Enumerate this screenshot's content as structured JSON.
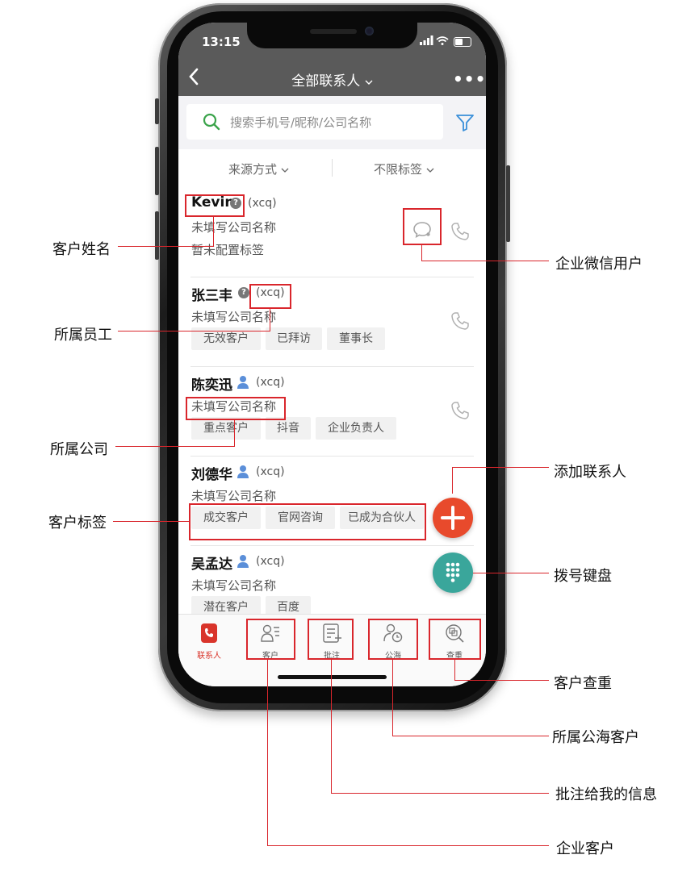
{
  "status_bar": {
    "time": "13:15"
  },
  "nav": {
    "title": "全部联系人",
    "title_dropdown_icon": "chevron-down-icon",
    "back_icon": "chevron-left-icon",
    "more_icon": "more-icon",
    "more_glyph": "•••"
  },
  "search": {
    "placeholder": "搜索手机号/昵称/公司名称"
  },
  "filters": [
    {
      "label": "来源方式"
    },
    {
      "label": "不限标签"
    }
  ],
  "contacts": [
    {
      "name": "Kevin",
      "staff": "(xcq)",
      "company": "未填写公司名称",
      "note": "暂未配置标签",
      "tags": [],
      "wechat_user": true
    },
    {
      "name": "张三丰",
      "staff": "(xcq)",
      "company": "未填写公司名称",
      "tags": [
        "无效客户",
        "已拜访",
        "董事长"
      ]
    },
    {
      "name": "陈奕迅",
      "staff": "(xcq)",
      "company": "未填写公司名称",
      "tags": [
        "重点客户",
        "抖音",
        "企业负责人"
      ]
    },
    {
      "name": "刘德华",
      "staff": "(xcq)",
      "company": "未填写公司名称",
      "tags": [
        "成交客户",
        "官网咨询",
        "已成为合伙人"
      ]
    },
    {
      "name": "吴孟达",
      "staff": "(xcq)",
      "company": "未填写公司名称",
      "tags": [
        "潜在客户",
        "百度"
      ]
    }
  ],
  "tabs": [
    {
      "label": "联系人",
      "active": true
    },
    {
      "label": "客户"
    },
    {
      "label": "批注"
    },
    {
      "label": "公海"
    },
    {
      "label": "查重"
    }
  ],
  "annotations": {
    "customer_name": "客户姓名",
    "wechat_user": "企业微信用户",
    "staff": "所属员工",
    "company": "所属公司",
    "add_contact": "添加联系人",
    "tags": "客户标签",
    "dial_pad": "拨号键盘",
    "dedupe": "客户查重",
    "public_pool": "所属公海客户",
    "annotations_to_me": "批注给我的信息",
    "enterprise_customer": "企业客户"
  },
  "colors": {
    "accent_red": "#d9262c",
    "fab_add": "#e84a2c",
    "fab_dial": "#3aa69b",
    "header": "#5a5a5a"
  }
}
